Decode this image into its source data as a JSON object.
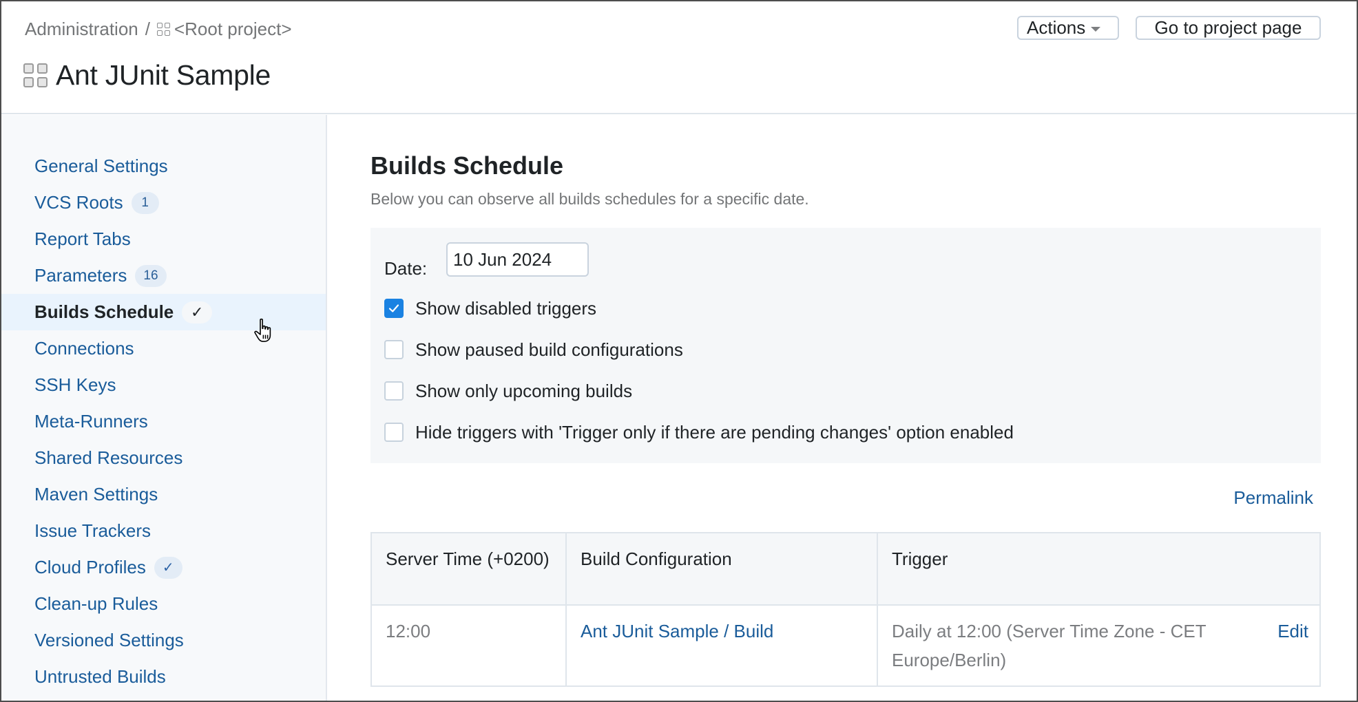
{
  "header": {
    "breadcrumb": {
      "root": "Administration",
      "separator": "/",
      "project_icon": "project-grid-icon",
      "project": "<Root project>"
    },
    "title": "Ant JUnit Sample",
    "title_icon": "project-grid-icon",
    "actions_label": "Actions",
    "goto_label": "Go to project page"
  },
  "sidebar": {
    "items": [
      {
        "label": "General Settings"
      },
      {
        "label": "VCS Roots",
        "badge": "1"
      },
      {
        "label": "Report Tabs"
      },
      {
        "label": "Parameters",
        "badge": "16"
      },
      {
        "label": "Builds Schedule",
        "badge": "✓",
        "active": true
      },
      {
        "label": "Connections"
      },
      {
        "label": "SSH Keys"
      },
      {
        "label": "Meta-Runners"
      },
      {
        "label": "Shared Resources"
      },
      {
        "label": "Maven Settings"
      },
      {
        "label": "Issue Trackers"
      },
      {
        "label": "Cloud Profiles",
        "badge": "✓"
      },
      {
        "label": "Clean-up Rules"
      },
      {
        "label": "Versioned Settings"
      },
      {
        "label": "Untrusted Builds"
      }
    ]
  },
  "main": {
    "title": "Builds Schedule",
    "description": "Below you can observe all builds schedules for a specific date.",
    "filters": {
      "date_label": "Date:",
      "date_value": "10 Jun 2024",
      "checkboxes": [
        {
          "label": "Show disabled triggers",
          "checked": true
        },
        {
          "label": "Show paused build configurations",
          "checked": false
        },
        {
          "label": "Show only upcoming builds",
          "checked": false
        },
        {
          "label": "Hide triggers with 'Trigger only if there are pending changes' option enabled",
          "checked": false
        }
      ]
    },
    "permalink": "Permalink",
    "table": {
      "headers": [
        "Server Time (+0200)",
        "Build Configuration",
        "Trigger"
      ],
      "rows": [
        {
          "time": "12:00",
          "build_configuration": "Ant JUnit Sample / Build",
          "trigger": "Daily at 12:00 (Server Time Zone - CET Europe/Berlin)",
          "action": "Edit"
        }
      ]
    }
  },
  "colors": {
    "link": "#1a5c9a",
    "checkbox_checked": "#1a82e2",
    "active_sidebar_bg": "#e9f3fd",
    "sidebar_bg": "#f7f9fb"
  }
}
